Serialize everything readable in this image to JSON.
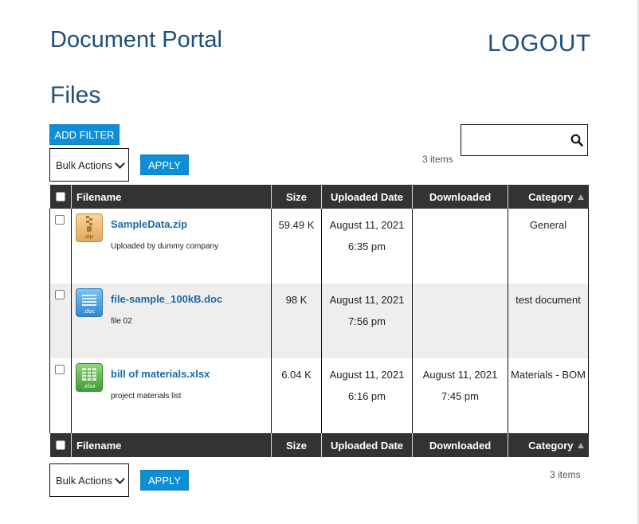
{
  "header": {
    "title": "Document Portal",
    "logout_label": "LOGOUT"
  },
  "page": {
    "heading": "Files"
  },
  "toolbar": {
    "add_filter_label": "ADD FILTER",
    "bulk_actions_selected": "Bulk Actions",
    "apply_label": "APPLY",
    "search_placeholder": "",
    "items_count": "3 items"
  },
  "table": {
    "columns": {
      "filename": "Filename",
      "size": "Size",
      "uploaded_date": "Uploaded Date",
      "downloaded": "Downloaded",
      "category": "Category"
    },
    "sorted_column": "Category",
    "sort_direction": "ascending",
    "rows": [
      {
        "icon": "zip-file-icon",
        "icon_tag": "zip",
        "name": "SampleData.zip",
        "description": "Uploaded by dummy company",
        "size": "59.49 K",
        "uploaded_date": "August 11, 2021",
        "uploaded_time": "6:35 pm",
        "downloaded_date": "",
        "downloaded_time": "",
        "category": "General"
      },
      {
        "icon": "doc-file-icon",
        "icon_tag": ".doc",
        "name": "file-sample_100kB.doc",
        "description": "file 02",
        "size": "98 K",
        "uploaded_date": "August 11, 2021",
        "uploaded_time": "7:56 pm",
        "downloaded_date": "",
        "downloaded_time": "",
        "category": "test document"
      },
      {
        "icon": "xlsx-file-icon",
        "icon_tag": ".xlsx",
        "name": "bill of materials.xlsx",
        "description": "project materials list",
        "size": "6.04 K",
        "uploaded_date": "August 11, 2021",
        "uploaded_time": "6:16 pm",
        "downloaded_date": "August 11, 2021",
        "downloaded_time": "7:45 pm",
        "category": "Materials - BOM"
      }
    ]
  },
  "footer_toolbar": {
    "bulk_actions_selected": "Bulk Actions",
    "apply_label": "APPLY",
    "items_count": "3 items"
  },
  "colors": {
    "accent": "#0d8fd6",
    "title": "#1d4f7c",
    "header_bg": "#333333",
    "link": "#1a6aa8"
  }
}
